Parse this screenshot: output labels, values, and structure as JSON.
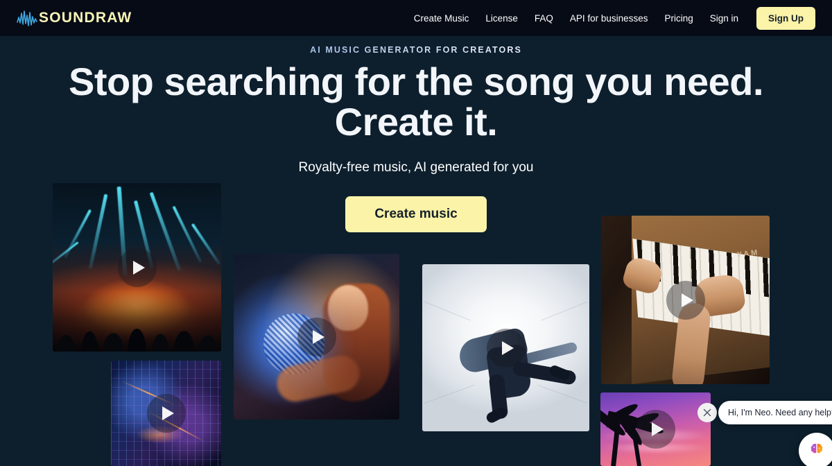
{
  "brand": {
    "name": "SOUNDRAW",
    "logo_icon": "sound-wave-icon",
    "logo_text_color": "#faf6b8",
    "wave_color": "#3fa9e0"
  },
  "header": {
    "background": "#070b16",
    "nav_items": [
      {
        "label": "Create Music",
        "name": "nav-create-music"
      },
      {
        "label": "License",
        "name": "nav-license"
      },
      {
        "label": "FAQ",
        "name": "nav-faq"
      },
      {
        "label": "API for businesses",
        "name": "nav-api-for-businesses"
      },
      {
        "label": "Pricing",
        "name": "nav-pricing"
      },
      {
        "label": "Sign in",
        "name": "nav-sign-in"
      }
    ],
    "signup_label": "Sign Up",
    "signup_bg": "#faf3a8",
    "signup_text_color": "#16202b"
  },
  "hero": {
    "eyebrow": "AI MUSIC GENERATOR FOR CREATORS",
    "headline_line1": "Stop searching for the song you need.",
    "headline_line2": "Create it.",
    "subtitle": "Royalty-free music, AI generated for you",
    "cta_label": "Create music",
    "cta_bg": "#faf3a8",
    "background": "#0d1f2d"
  },
  "media_cards": [
    {
      "name": "media-card-concert",
      "alt": "Concert stage with cyan laser beams over a crowd",
      "play_icon": "play-icon"
    },
    {
      "name": "media-card-city",
      "alt": "Aerial night cityscape with neon lights",
      "play_icon": "play-icon"
    },
    {
      "name": "media-card-disco",
      "alt": "Woman holding a mirrored disco ball",
      "play_icon": "play-icon"
    },
    {
      "name": "media-card-dancer",
      "alt": "Breakdancer mid-move in a white studio",
      "play_icon": "play-icon"
    },
    {
      "name": "media-card-piano",
      "alt": "Hands playing a wooden Yamaha piano",
      "play_icon": "play-icon",
      "brand_text": "YAM"
    },
    {
      "name": "media-card-tropical",
      "alt": "Palm trees silhouetted against a purple sunset",
      "play_icon": "play-icon"
    }
  ],
  "chat_widget": {
    "message": "Hi, I'm Neo. Need any help?",
    "close_icon": "close-icon",
    "launcher_icon": "brain-avatar-icon",
    "bubble_bg": "#ffffff",
    "bubble_text_color": "#1b2230"
  }
}
